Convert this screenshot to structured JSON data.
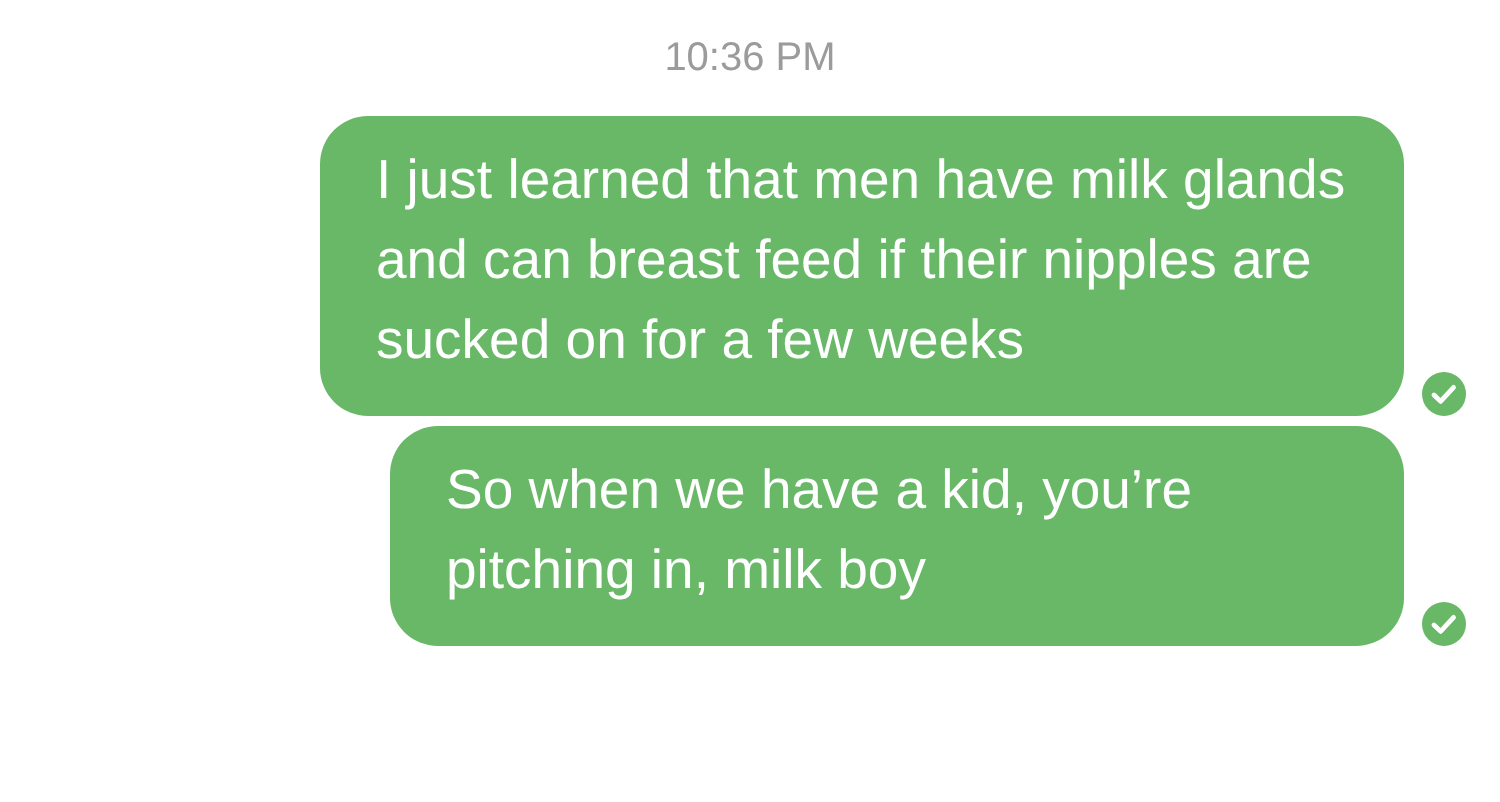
{
  "timestamp": "10:36 PM",
  "messages": [
    {
      "text": "I just learned that men have milk glands and can breast feed if their nipples are sucked on for a few weeks",
      "delivered": true
    },
    {
      "text": "So when we have a kid, you’re pitching in, milk boy",
      "delivered": true
    }
  ]
}
